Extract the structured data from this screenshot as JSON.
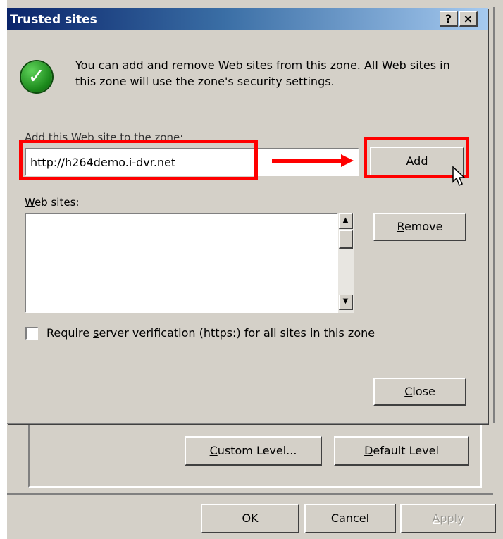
{
  "dialog": {
    "title": "Trusted sites",
    "help_button": "?",
    "close_button": "×",
    "info_text": "You can add and remove Web sites from this zone. All Web sites in this zone will use the zone's security settings.",
    "add_label": "Add this Web site to the zone:",
    "url_value": "http://h264demo.i-dvr.net",
    "add_button": {
      "mnemonic": "A",
      "rest": "dd"
    },
    "websites_label": {
      "mnemonic": "W",
      "rest": "eb sites:"
    },
    "remove_button": {
      "mnemonic": "R",
      "rest": "emove"
    },
    "checkbox_label": {
      "before": "Require ",
      "mnemonic": "s",
      "after": "erver verification (https:) for all sites in this zone"
    },
    "checkbox_checked": false,
    "close_dialog_button": {
      "mnemonic": "C",
      "rest": "lose"
    }
  },
  "parent": {
    "custom_level_button": {
      "mnemonic": "C",
      "rest": "ustom Level..."
    },
    "default_level_button": {
      "mnemonic": "D",
      "rest": "efault Level"
    },
    "ok_button": "OK",
    "cancel_button": "Cancel",
    "apply_button": {
      "mnemonic": "A",
      "rest": "pply"
    }
  },
  "icons": {
    "info": "check-icon",
    "scroll_up": "scroll-up-icon",
    "scroll_down": "scroll-down-icon",
    "cursor": "mouse-pointer-icon"
  },
  "colors": {
    "annotation": "#ff0000",
    "dialog_bg": "#d4d0c8",
    "title_start": "#0a246a",
    "check_green": "#1c8a1c"
  }
}
